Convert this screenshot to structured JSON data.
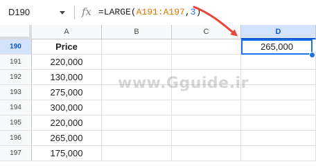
{
  "formula_bar": {
    "name_box": "D190",
    "fx": "fx",
    "formula_prefix": "=LARGE(",
    "formula_ref": "A191:A197",
    "formula_sep": ",",
    "formula_num": "3",
    "formula_suffix": ")"
  },
  "columns": [
    "A",
    "B",
    "C",
    "D"
  ],
  "rows": [
    "190",
    "191",
    "192",
    "193",
    "194",
    "195",
    "196",
    "197"
  ],
  "cells": {
    "header": "Price",
    "values": [
      "220,000",
      "130,000",
      "275,000",
      "300,000",
      "220,000",
      "265,000",
      "175,000"
    ]
  },
  "active_cell_value": "265,000",
  "watermark": "www.Gguide.ir",
  "colors": {
    "accent": "#1a73e8",
    "arrow": "#e8453c",
    "selected_header": "#d3e3fd"
  }
}
